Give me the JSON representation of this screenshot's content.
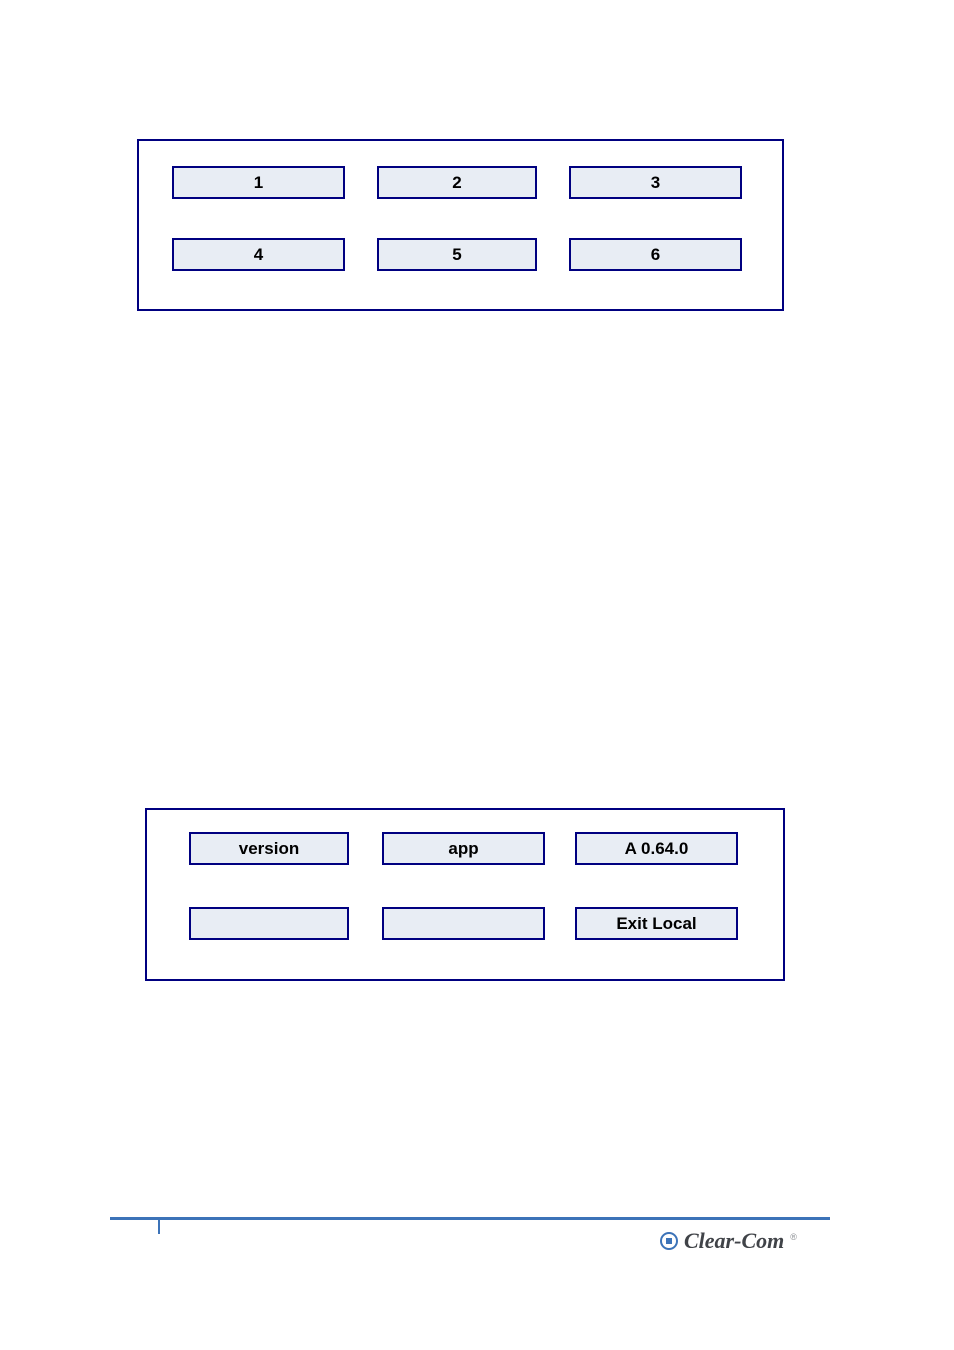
{
  "panel_top": {
    "rows": [
      {
        "c1": "1",
        "c2": "2",
        "c3": "3"
      },
      {
        "c1": "4",
        "c2": "5",
        "c3": "6"
      }
    ]
  },
  "panel_bottom": {
    "rows": [
      {
        "c1": "version",
        "c2": "app",
        "c3": "A 0.64.0"
      },
      {
        "c1": "",
        "c2": "",
        "c3": "Exit Local"
      }
    ]
  },
  "footer": {
    "brand": "Clear-Com",
    "registered": "®"
  }
}
